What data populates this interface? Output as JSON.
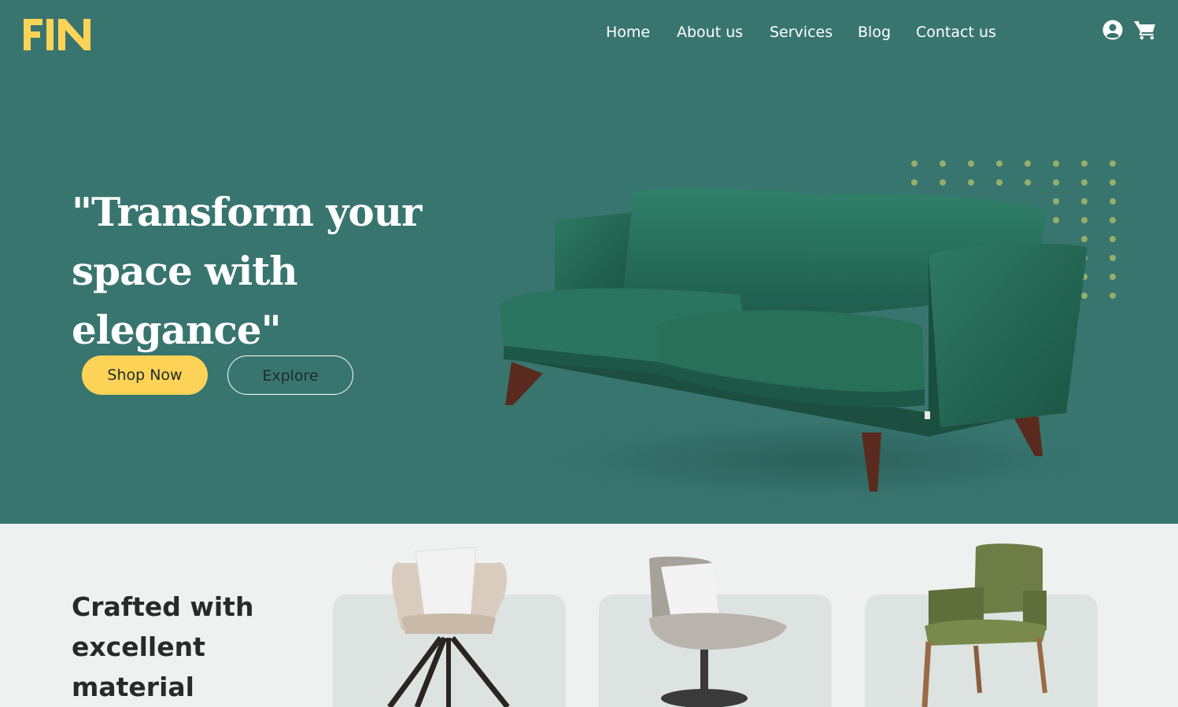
{
  "brand": {
    "logo_text": "FIN",
    "logo_color": "#fcd357"
  },
  "nav": {
    "items": [
      "Home",
      "About us",
      "Services",
      "Blog",
      "Contact us"
    ]
  },
  "header_icons": {
    "account": "user-icon",
    "cart": "cart-icon"
  },
  "hero": {
    "headline_line1": "\"Transform your",
    "headline_line2": "space with elegance\"",
    "primary_button": "Shop Now",
    "secondary_button": "Explore",
    "background_color": "#39756f"
  },
  "section": {
    "heading_line1": "Crafted with",
    "heading_line2": "excellent",
    "heading_line3": "material",
    "products": [
      "beige-armchair-with-pillow",
      "grey-swivel-lounge-chair",
      "olive-green-dining-chair"
    ]
  }
}
